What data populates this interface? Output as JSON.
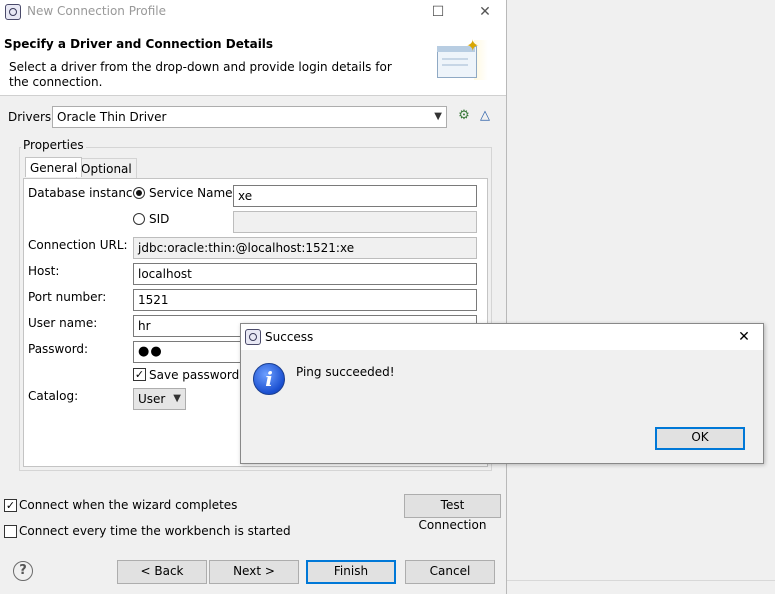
{
  "wizard": {
    "title": "New Connection Profile",
    "header_title": "Specify a Driver and Connection Details",
    "header_desc": "Select a driver from the drop-down and provide login details for the connection.",
    "drivers_label": "Drivers:",
    "driver_value": "Oracle Thin Driver",
    "properties_label": "Properties",
    "tabs": [
      {
        "label": "General"
      },
      {
        "label": "Optional"
      }
    ],
    "database_instance_label": "Database instance:",
    "service_name_label": "Service Name",
    "service_name_value": "xe",
    "sid_label": "SID",
    "sid_value": "",
    "connection_url_label": "Connection URL:",
    "connection_url_value": "jdbc:oracle:thin:@localhost:1521:xe",
    "host_label": "Host:",
    "host_value": "localhost",
    "port_label": "Port number:",
    "port_value": "1521",
    "username_label": "User name:",
    "username_value": "hr",
    "password_label": "Password:",
    "password_value": "●●",
    "save_password_label": "Save password",
    "catalog_label": "Catalog:",
    "catalog_value": "User",
    "connect_when_complete_label": "Connect when the wizard completes",
    "connect_every_time_label": "Connect every time the workbench is started",
    "test_connection_label": "Test Connection",
    "back_label": "< Back",
    "next_label": "Next >",
    "finish_label": "Finish",
    "cancel_label": "Cancel",
    "help_glyph": "?"
  },
  "dialog": {
    "title": "Success",
    "message": "Ping succeeded!",
    "ok_label": "OK",
    "info_glyph": "i",
    "close_glyph": "✕"
  },
  "states": {
    "service_name_selected": true,
    "sid_selected": false,
    "save_password_checked": true,
    "connect_when_complete_checked": true,
    "connect_every_time_checked": false
  },
  "icons": [
    "app-icon",
    "minimize-icon",
    "maximize-icon",
    "close-icon",
    "new-driver-icon",
    "edit-driver-icon",
    "wizard-banner-icon",
    "help-icon",
    "info-icon",
    "chevron-down-icon",
    "checkmark-icon"
  ],
  "colors": {
    "accent": "#0078d7",
    "info_blue": "#1a4fd0"
  }
}
